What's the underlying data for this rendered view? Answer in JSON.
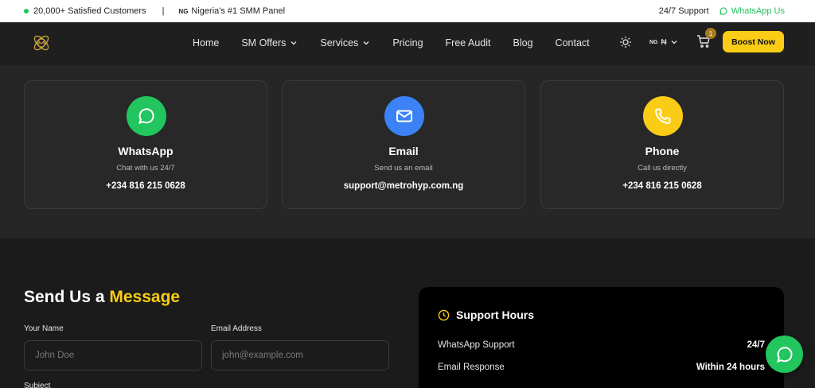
{
  "topbar": {
    "customers": "20,000+ Satisfied Customers",
    "separator": "|",
    "flag_code": "NG",
    "tagline": "Nigeria's #1 SMM Panel",
    "support": "24/7 Support",
    "whatsapp": "WhatsApp Us"
  },
  "nav": {
    "items": [
      {
        "label": "Home",
        "dropdown": false
      },
      {
        "label": "SM Offers",
        "dropdown": true
      },
      {
        "label": "Services",
        "dropdown": true
      },
      {
        "label": "Pricing",
        "dropdown": false
      },
      {
        "label": "Free Audit",
        "dropdown": false
      },
      {
        "label": "Blog",
        "dropdown": false
      },
      {
        "label": "Contact",
        "dropdown": false
      }
    ],
    "currency_flag": "NG",
    "currency": "₦",
    "cart_count": "1",
    "boost_label": "Boost Now"
  },
  "cards": [
    {
      "title": "WhatsApp",
      "subtitle": "Chat with us 24/7",
      "value": "+234 816 215 0628",
      "color": "#22c55e",
      "icon": "whatsapp-icon"
    },
    {
      "title": "Email",
      "subtitle": "Send us an email",
      "value": "support@metrohyp.com.ng",
      "color": "#3b82f6",
      "icon": "mail-icon"
    },
    {
      "title": "Phone",
      "subtitle": "Call us directly",
      "value": "+234 816 215 0628",
      "color": "#facc15",
      "icon": "phone-icon"
    }
  ],
  "form": {
    "title_main": "Send Us a ",
    "title_accent": "Message",
    "name_label": "Your Name",
    "name_placeholder": "John Doe",
    "email_label": "Email Address",
    "email_placeholder": "john@example.com",
    "subject_label": "Subject"
  },
  "support_hours": {
    "title": "Support Hours",
    "rows": [
      {
        "label": "WhatsApp Support",
        "value": "24/7"
      },
      {
        "label": "Email Response",
        "value": "Within 24 hours"
      }
    ]
  },
  "colors": {
    "accent": "#facc15",
    "whatsapp": "#22c55e",
    "email": "#3b82f6"
  }
}
